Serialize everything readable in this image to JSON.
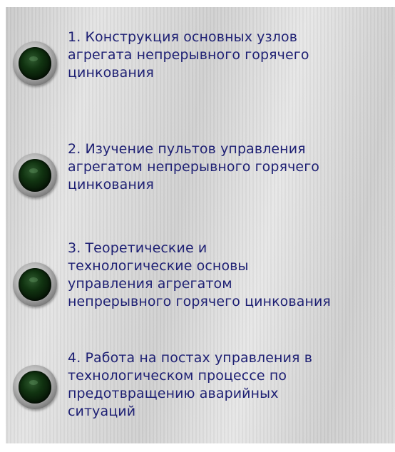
{
  "menu": {
    "items": [
      {
        "number": "1.",
        "title": "Конструкция основных узлов\nагрегата непрерывного горячего\nцинкования"
      },
      {
        "number": "2.",
        "title": "Изучение пультов управления\nагрегатом непрерывного горячего\nцинкования"
      },
      {
        "number": "3.",
        "title": "Теоретические и\nтехнологические основы\nуправления агрегатом\nнепрерывного горячего цинкования"
      },
      {
        "number": "4.",
        "title": "Работа на постах управления в\nтехнологическом процессе по\nпредотвращению аварийных\nситуаций"
      }
    ]
  },
  "colors": {
    "text": "#1d1f73",
    "lamp": "#0b2a0b"
  }
}
